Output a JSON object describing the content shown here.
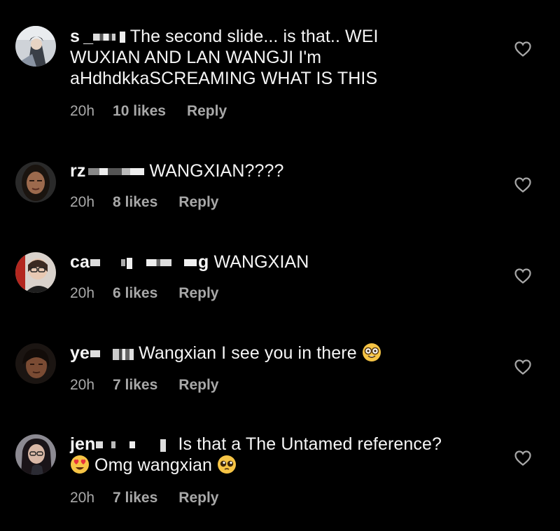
{
  "comments": [
    {
      "username": "s _",
      "text_lines": [
        "The second slide... is that.. WEI",
        "WUXIAN AND LAN WANGJI I'm",
        "aHdhdkkaSCREAMING WHAT IS THIS"
      ],
      "time": "20h",
      "likes": "10 likes",
      "reply": "Reply"
    },
    {
      "username": "rz",
      "text_lines": [
        "WANGXIAN????"
      ],
      "time": "20h",
      "likes": "8 likes",
      "reply": "Reply"
    },
    {
      "username": "ca",
      "username_tail": "g",
      "text_lines": [
        "WANGXIAN"
      ],
      "time": "20h",
      "likes": "6 likes",
      "reply": "Reply"
    },
    {
      "username": "ye",
      "text_lines": [
        "Wangxian I see you in there"
      ],
      "emoji_end": "nerd-face",
      "time": "20h",
      "likes": "7 likes",
      "reply": "Reply"
    },
    {
      "username": "jen",
      "text_lines": [
        "Is that a The Untamed reference?",
        "Omg wangxian"
      ],
      "emoji_line2_start": "heart-eyes-face",
      "emoji_line2_end": "pleading-face",
      "time": "20h",
      "likes": "7 likes",
      "reply": "Reply"
    }
  ],
  "colors": {
    "background": "#000000",
    "text": "#f5f5f5",
    "meta": "#a8a8a8",
    "heart": "#a8a8a8"
  },
  "icons": {
    "like": "heart-outline-icon"
  }
}
